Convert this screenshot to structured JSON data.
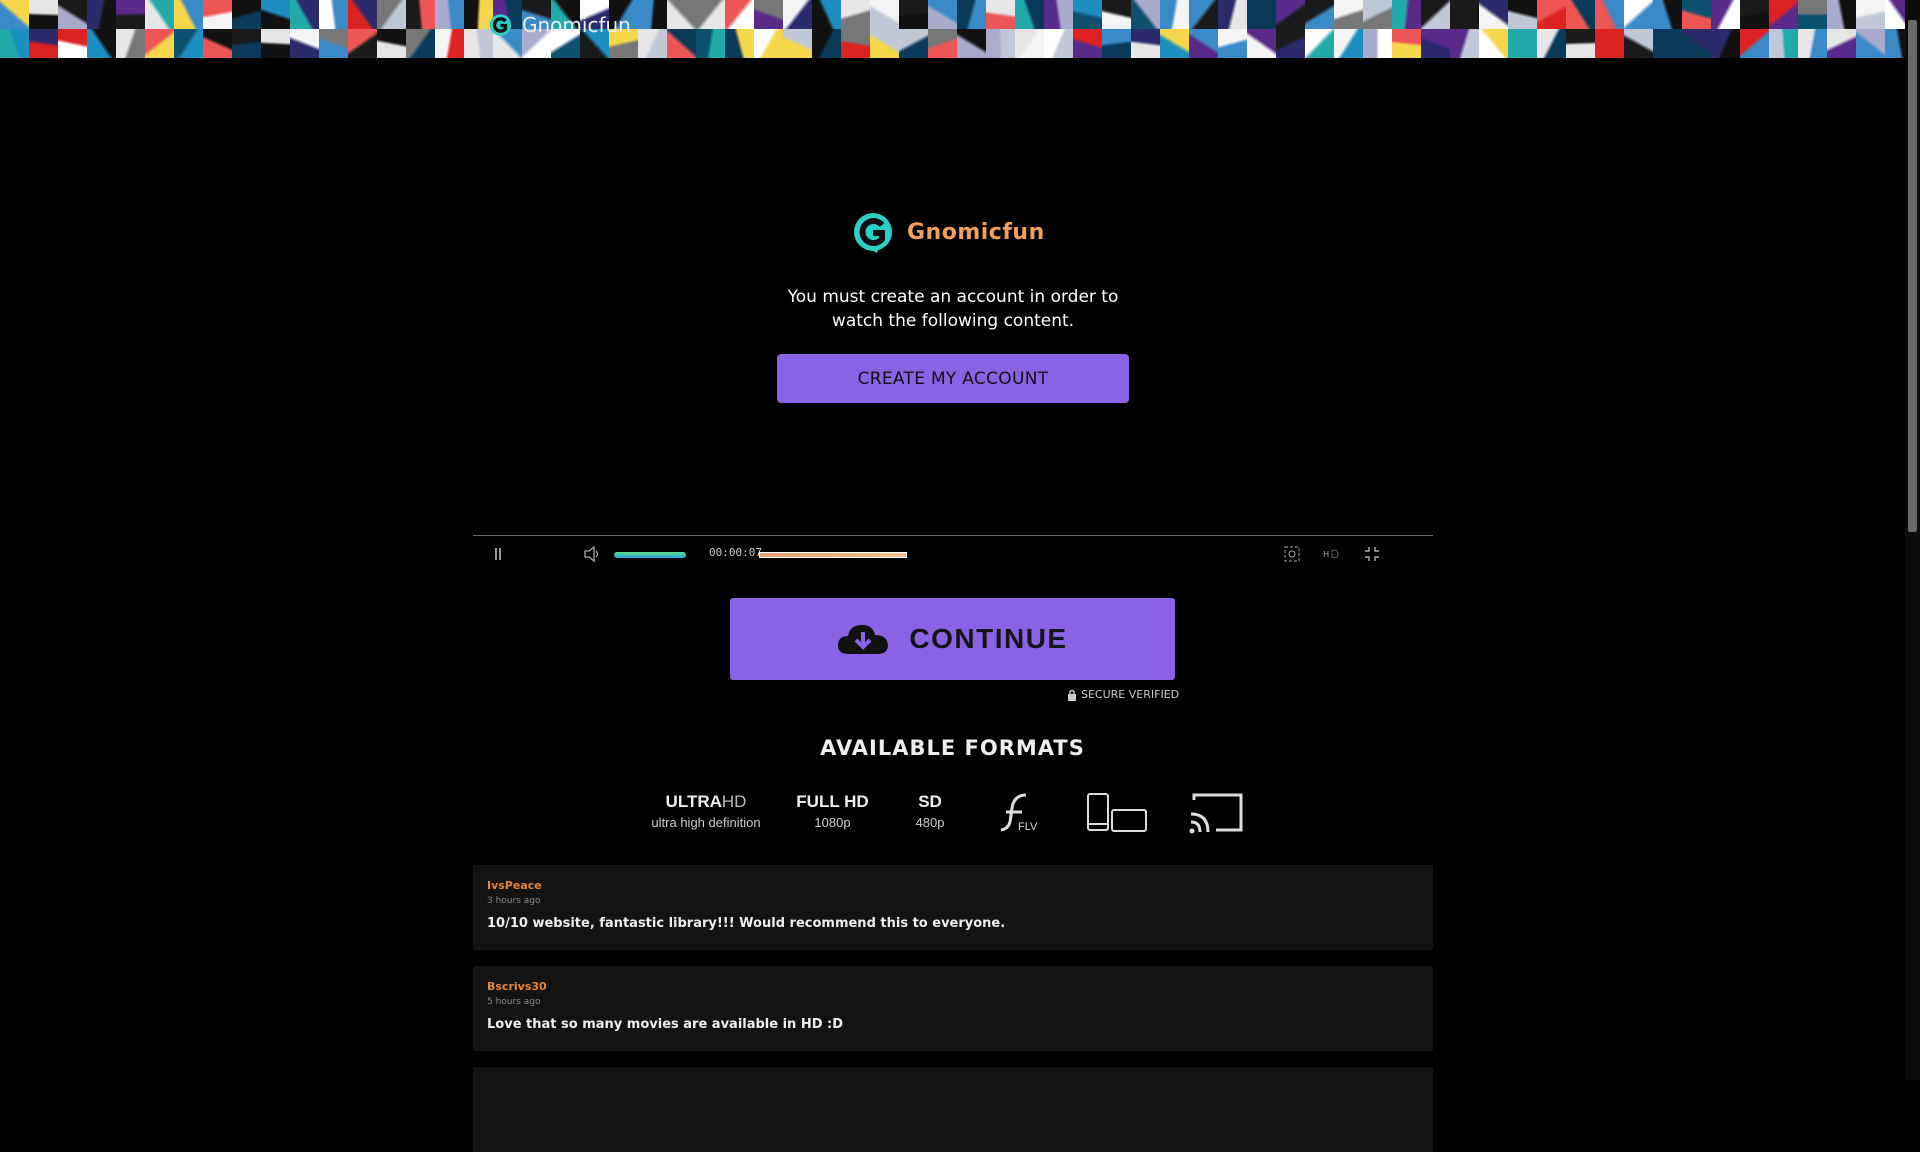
{
  "header": {
    "site_name": "Gnomicfun",
    "logo_icon": "g-logo-icon"
  },
  "gate": {
    "brand": "Gnomicfun",
    "message": "You must create an account in order to watch the following content.",
    "create_button": "CREATE MY ACCOUNT"
  },
  "player": {
    "time": "00:00:07",
    "volume_fraction": 1.0,
    "progress_fraction": 1.0
  },
  "download": {
    "continue_label": "CONTINUE",
    "secure_text": "SECURE VERIFIED"
  },
  "formats": {
    "title": "AVAILABLE FORMATS",
    "items": [
      {
        "big_bold": "ULTRA",
        "big_thin": "HD",
        "small": "ultra high definition"
      },
      {
        "big_bold": "FULL HD",
        "big_thin": "",
        "small": "1080p"
      },
      {
        "big_bold": "SD",
        "big_thin": "",
        "small": "480p"
      }
    ],
    "flv_label": "FLV"
  },
  "comments": [
    {
      "user": "IvsPeace",
      "time": "3 hours ago",
      "text": "10/10 website, fantastic library!!! Would recommend this to everyone."
    },
    {
      "user": "Bscrivs30",
      "time": "5 hours ago",
      "text": "Love that so many movies are available in HD :D"
    }
  ],
  "colors": {
    "accent": "#8a62e6",
    "brand_orange": "#f2a15a",
    "logo_teal": "#2ad0c8",
    "username": "#e8863a"
  }
}
